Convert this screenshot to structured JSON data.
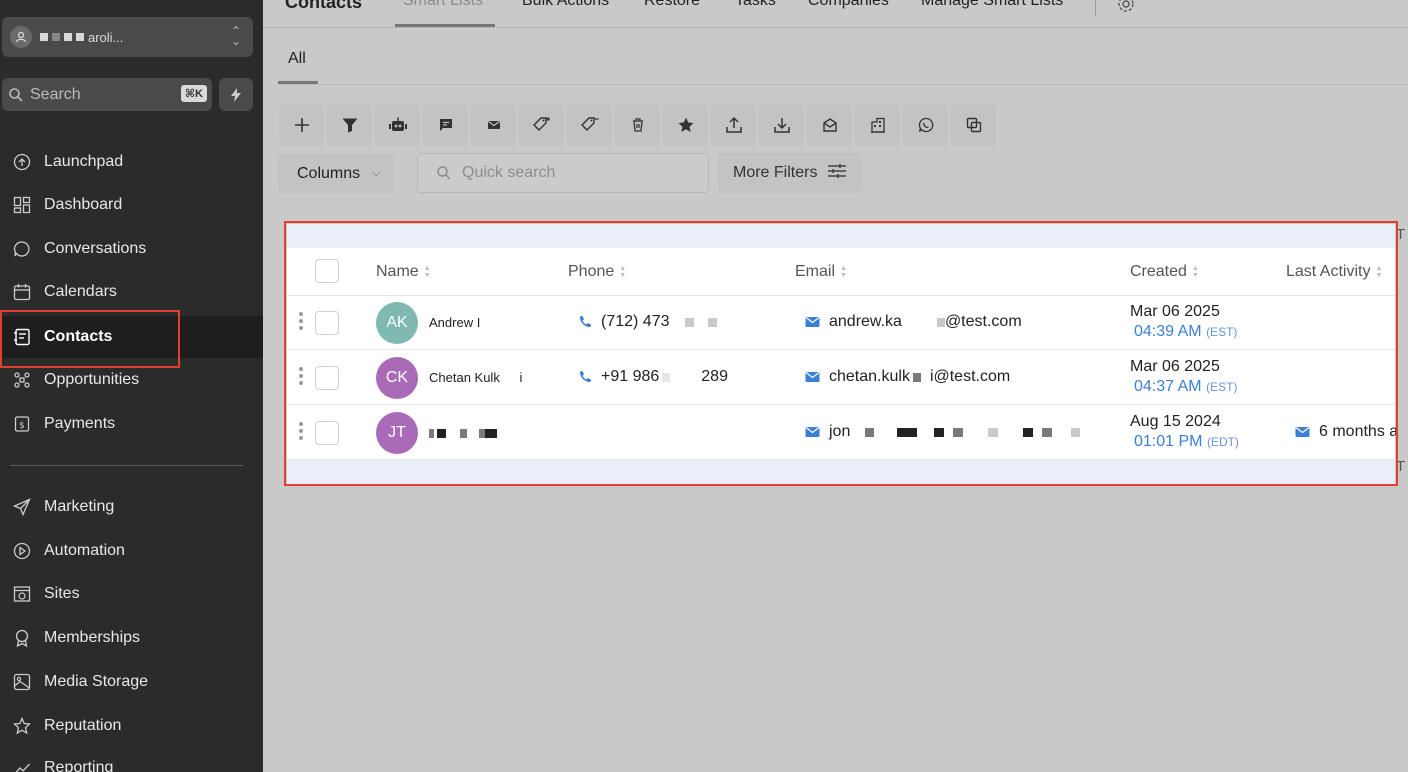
{
  "account": {
    "name": "aroli..."
  },
  "search": {
    "label": "Search",
    "shortcut": "⌘K"
  },
  "sidebar": {
    "items": [
      {
        "label": "Launchpad",
        "icon": "launchpad-icon"
      },
      {
        "label": "Dashboard",
        "icon": "dashboard-icon"
      },
      {
        "label": "Conversations",
        "icon": "chat-bubble-icon"
      },
      {
        "label": "Calendars",
        "icon": "calendar-icon"
      },
      {
        "label": "Contacts",
        "icon": "contact-card-icon",
        "active": true
      },
      {
        "label": "Opportunities",
        "icon": "opportunities-icon"
      },
      {
        "label": "Payments",
        "icon": "payments-icon"
      }
    ],
    "items2": [
      {
        "label": "Marketing",
        "icon": "send-icon"
      },
      {
        "label": "Automation",
        "icon": "automation-icon"
      },
      {
        "label": "Sites",
        "icon": "globe-icon"
      },
      {
        "label": "Memberships",
        "icon": "badge-icon"
      },
      {
        "label": "Media Storage",
        "icon": "image-icon"
      },
      {
        "label": "Reputation",
        "icon": "star-icon"
      },
      {
        "label": "Reporting",
        "icon": "chart-icon"
      }
    ]
  },
  "topnav": {
    "title": "Contacts",
    "tabs": [
      "Smart Lists",
      "Bulk Actions",
      "Restore",
      "Tasks",
      "Companies",
      "Manage Smart Lists"
    ]
  },
  "subtabs": {
    "all": "All"
  },
  "toolbar": {
    "columns_label": "Columns",
    "quick_search_placeholder": "Quick search",
    "more_filters_label": "More Filters"
  },
  "table": {
    "headers": {
      "name": "Name",
      "phone": "Phone",
      "email": "Email",
      "created": "Created",
      "last_activity": "Last Activity"
    },
    "rows": [
      {
        "initials": "AK",
        "avatar_color": "#7fb9b1",
        "name": "Andrew I",
        "phone_a": "(712) 473",
        "phone_b": "",
        "email_a": "andrew.ka",
        "email_b": "@test.com",
        "created_date": "Mar 06 2025",
        "created_time": "04:39 AM",
        "created_tz": "(EST)",
        "last_activity": ""
      },
      {
        "initials": "CK",
        "avatar_color": "#a96bb7",
        "name": "Chetan Kulk",
        "name_b": "i",
        "phone_a": "+91 986",
        "phone_b": "289",
        "email_a": "chetan.kulk",
        "email_b": "i@test.com",
        "created_date": "Mar 06 2025",
        "created_time": "04:37 AM",
        "created_tz": "(EST)",
        "last_activity": ""
      },
      {
        "initials": "JT",
        "avatar_color": "#a96bb7",
        "name": "",
        "phone_a": "",
        "phone_b": "",
        "email_a": "jon",
        "email_b": "",
        "created_date": "Aug 15 2024",
        "created_time": "01:01 PM",
        "created_tz": "(EDT)",
        "last_activity": "6 months a"
      }
    ]
  },
  "edge": {
    "t": "T"
  },
  "colors": {
    "accent_blue": "#3c7fd6",
    "highlight_red": "#e0412e",
    "sidebar_bg": "#2b2b2b"
  }
}
